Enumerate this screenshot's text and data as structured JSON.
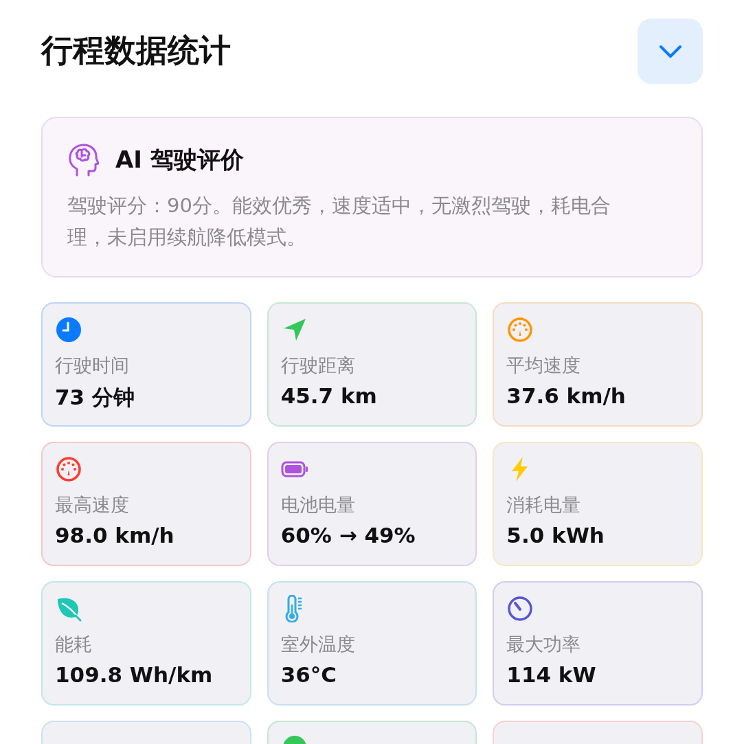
{
  "title": "行程数据统计",
  "ai_card": {
    "heading": "AI 驾驶评价",
    "text": "驾驶评分：90分。能效优秀，速度适中，无激烈驾驶，耗电合理，未启用续航降低模式。"
  },
  "stats": [
    {
      "kind": "clock",
      "color": "#0a7aff",
      "label": "行驶时间",
      "value": "73 分钟"
    },
    {
      "kind": "arrow",
      "color": "#34c759",
      "label": "行驶距离",
      "value": "45.7 km"
    },
    {
      "kind": "gauge",
      "color": "#ff9500",
      "label": "平均速度",
      "value": "37.6 km/h"
    },
    {
      "kind": "gauge",
      "color": "#ff3b30",
      "label": "最高速度",
      "value": "98.0 km/h"
    },
    {
      "kind": "battery",
      "color": "#af52de",
      "label": "电池电量",
      "value": "60% → 49%"
    },
    {
      "kind": "bolt",
      "color": "#ffcc00",
      "label": "消耗电量",
      "value": "5.0 kWh"
    },
    {
      "kind": "leaf",
      "color": "#1ec8b4",
      "label": "能耗",
      "value": "109.8 Wh/km"
    },
    {
      "kind": "thermometer",
      "color": "#32ade6",
      "label": "室外温度",
      "value": "36°C"
    },
    {
      "kind": "dial",
      "color": "#5856d6",
      "label": "最大功率",
      "value": "114 kW"
    }
  ],
  "partial_cards": [
    {
      "kind": "blank",
      "color": "#cde3f0"
    },
    {
      "kind": "dot",
      "color": "#34c759"
    },
    {
      "kind": "blank",
      "color": "#f6d2d3"
    }
  ]
}
